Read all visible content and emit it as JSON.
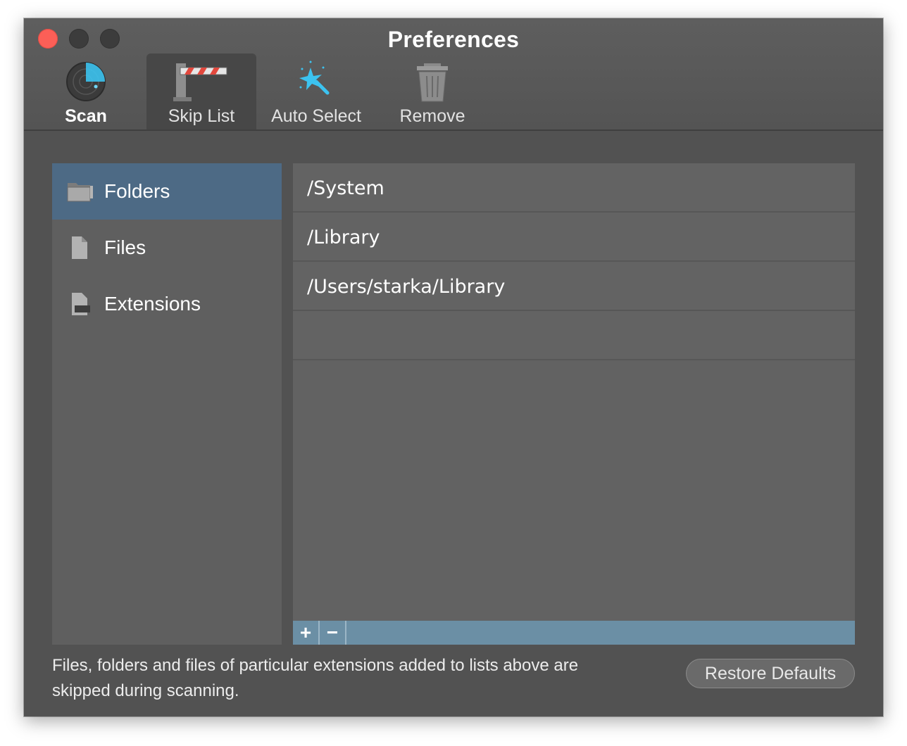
{
  "window": {
    "title": "Preferences"
  },
  "toolbar": {
    "items": [
      {
        "label": "Scan",
        "icon": "radar-icon"
      },
      {
        "label": "Skip List",
        "icon": "barrier-icon",
        "active": true
      },
      {
        "label": "Auto Select",
        "icon": "magic-wand-icon"
      },
      {
        "label": "Remove",
        "icon": "trash-icon"
      }
    ]
  },
  "sidebar": {
    "items": [
      {
        "label": "Folders",
        "icon": "folder-icon",
        "selected": true
      },
      {
        "label": "Files",
        "icon": "file-icon"
      },
      {
        "label": "Extensions",
        "icon": "extension-icon"
      }
    ]
  },
  "list": {
    "rows": [
      "/System",
      "/Library",
      "/Users/starka/Library",
      ""
    ],
    "add_label": "+",
    "remove_label": "−"
  },
  "footer": {
    "description": "Files, folders and files of particular extensions added to lists above are skipped during scanning.",
    "restore_label": "Restore Defaults"
  },
  "colors": {
    "close_button": "#fc5f57",
    "selection": "#4d6a85",
    "list_footer": "#6b8fa5",
    "accent_icon": "#3cc3f0"
  }
}
